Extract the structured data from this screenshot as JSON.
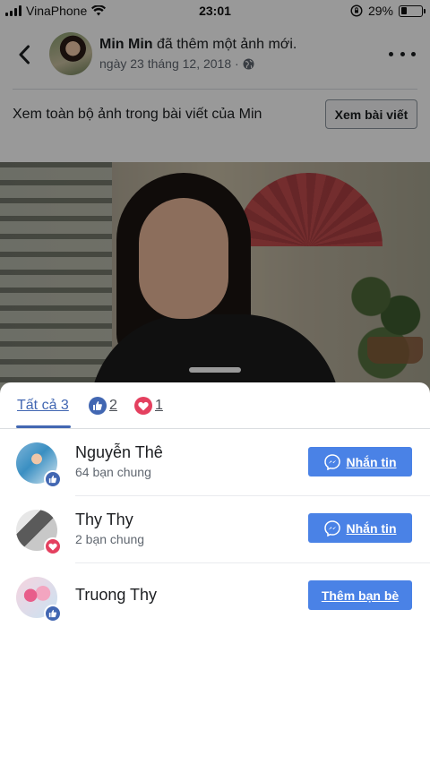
{
  "status_bar": {
    "carrier": "VinaPhone",
    "time": "23:01",
    "battery": "29%",
    "battery_level": 0.29
  },
  "post": {
    "author": "Min Min",
    "action": " đã thêm một ảnh mới.",
    "date": "ngày 23 tháng 12, 2018 ·",
    "album_prompt": "Xem toàn bộ ảnh trong bài viết của Min",
    "album_button": "Xem bài viết"
  },
  "reactions": {
    "tabs": [
      {
        "label": "Tất cả 3",
        "icon": "none"
      },
      {
        "label": "2",
        "icon": "like-icon"
      },
      {
        "label": "1",
        "icon": "love-icon"
      }
    ],
    "people": [
      {
        "name": "Nguyễn Thê",
        "mutual": "64 bạn chung",
        "reaction": "like",
        "button": "Nhắn tin",
        "button_icon": "messenger-icon"
      },
      {
        "name": "Thy Thy",
        "mutual": "2 bạn chung",
        "reaction": "love",
        "button": "Nhắn tin",
        "button_icon": "messenger-icon"
      },
      {
        "name": "Truong Thy",
        "mutual": "",
        "reaction": "like",
        "button": "Thêm bạn bè",
        "button_icon": "none"
      }
    ]
  },
  "colors": {
    "facebook_blue": "#4267b2",
    "button_blue": "#4a82e6",
    "love_red": "#e4405f"
  }
}
